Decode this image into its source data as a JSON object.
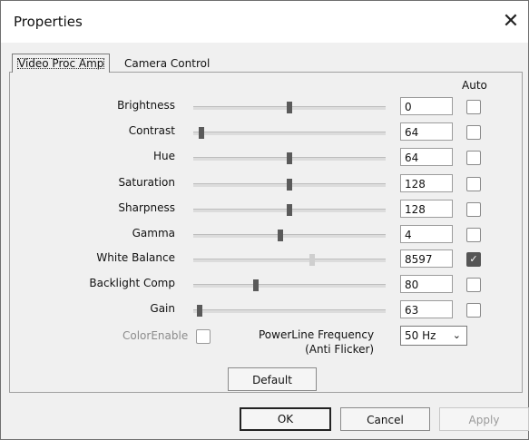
{
  "window": {
    "title": "Properties"
  },
  "tabs": [
    {
      "label": "Video Proc Amp",
      "active": true
    },
    {
      "label": "Camera Control",
      "active": false
    }
  ],
  "auto_header": "Auto",
  "controls": [
    {
      "label": "Brightness",
      "value": "0",
      "slider_fraction": 0.5,
      "auto": false
    },
    {
      "label": "Contrast",
      "value": "64",
      "slider_fraction": 0.03,
      "auto": false
    },
    {
      "label": "Hue",
      "value": "64",
      "slider_fraction": 0.5,
      "auto": false
    },
    {
      "label": "Saturation",
      "value": "128",
      "slider_fraction": 0.5,
      "auto": false
    },
    {
      "label": "Sharpness",
      "value": "128",
      "slider_fraction": 0.5,
      "auto": false
    },
    {
      "label": "Gamma",
      "value": "4",
      "slider_fraction": 0.45,
      "auto": false
    },
    {
      "label": "White Balance",
      "value": "8597",
      "slider_fraction": 0.62,
      "auto": true
    },
    {
      "label": "Backlight Comp",
      "value": "80",
      "slider_fraction": 0.32,
      "auto": false
    },
    {
      "label": "Gain",
      "value": "63",
      "slider_fraction": 0.02,
      "auto": false
    }
  ],
  "color_enable": {
    "label": "ColorEnable"
  },
  "powerline": {
    "label_line1": "PowerLine Frequency",
    "label_line2": "(Anti Flicker)",
    "selected": "50 Hz"
  },
  "buttons": {
    "default": "Default",
    "ok": "OK",
    "cancel": "Cancel",
    "apply": "Apply"
  },
  "icons": {
    "close": "close-icon",
    "dropdown": "chevron-down-icon",
    "check": "checkmark-icon"
  }
}
